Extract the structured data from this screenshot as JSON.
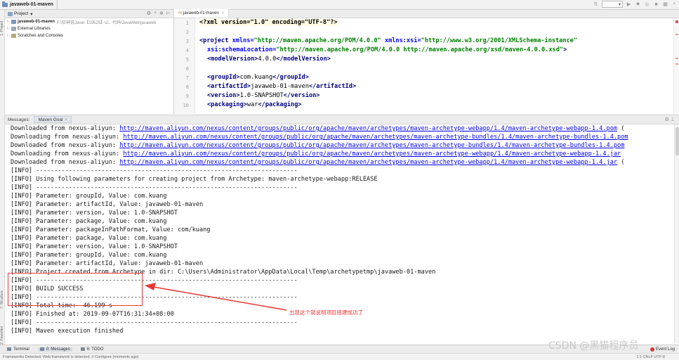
{
  "navbar": {
    "breadcrumb": "javaweb-01-maven",
    "run_config_value": "▾"
  },
  "left_strip": {
    "tabs": [
      "1: Project",
      "7: Structure",
      "2: Favorites"
    ]
  },
  "project_panel": {
    "title": "Project",
    "tree": [
      {
        "label": "javaweb-01-maven",
        "path": "F:\\狂神说Java\\【19525】\\2、代码\\JavaWeb\\javaweb"
      },
      {
        "label": "External Libraries",
        "path": ""
      },
      {
        "label": "Scratches and Consoles",
        "path": ""
      }
    ]
  },
  "editor": {
    "tab_label": "javaweb-01-maven",
    "line_numbers": [
      "1",
      "2",
      "3",
      "4",
      "5",
      "6",
      "7",
      "8",
      "9",
      "10"
    ],
    "lines": {
      "l1_pi": "<?xml version=\"1.0\" encoding=\"UTF-8\"?>",
      "l3_open": "<project ",
      "l3_a1": "xmlns=",
      "l3_v1": "\"http://maven.apache.org/POM/4.0.0\"",
      "l3_a2": " xmlns:xsi=",
      "l3_v2": "\"http://www.w3.org/2001/XMLSchema-instance\"",
      "l4_a": "xsi:schemaLocation=",
      "l4_v": "\"http://maven.apache.org/POM/4.0.0 http://maven.apache.org/xsd/maven-4.0.0.xsd\"",
      "l4_close": ">",
      "l5_o": "<modelVersion>",
      "l5_t": "4.0.0",
      "l5_c": "</modelVersion>",
      "l7_o": "<groupId>",
      "l7_t": "com.kuang",
      "l7_c": "</groupId>",
      "l8_o": "<artifactId>",
      "l8_t": "javaweb-01-maven",
      "l8_c": "</artifactId>",
      "l9_o": "<version>",
      "l9_t": "1.0-SNAPSHOT",
      "l9_c": "</version>",
      "l10_o": "<packaging>",
      "l10_t": "war",
      "l10_c": "</packaging>"
    }
  },
  "messages": {
    "label": "Messages:",
    "tab": "Maven Goal"
  },
  "console": {
    "downloads": [
      {
        "prefix": "Downloaded from nexus-aliyun: ",
        "url": "http://maven.aliyun.com/nexus/content/groups/public/org/apache/maven/archetypes/maven-archetype-webapp/1.4/maven-archetype-webapp-1.4.pom",
        "suffix": " ("
      },
      {
        "prefix": "Downloading from nexus-aliyun: ",
        "url": "http://maven.aliyun.com/nexus/content/groups/public/org/apache/maven/archetypes/maven-archetype-bundles/1.4/maven-archetype-bundles-1.4.pom",
        "suffix": ""
      },
      {
        "prefix": "Downloaded from nexus-aliyun: ",
        "url": "http://maven.aliyun.com/nexus/content/groups/public/org/apache/maven/archetypes/maven-archetype-bundles/1.4/maven-archetype-bundles-1.4.pom",
        "suffix": ""
      },
      {
        "prefix": "Downloading from nexus-aliyun: ",
        "url": "http://maven.aliyun.com/nexus/content/groups/public/org/apache/maven/archetypes/maven-archetype-webapp/1.4/maven-archetype-webapp-1.4.jar",
        "suffix": ""
      },
      {
        "prefix": "Downloaded from nexus-aliyun: ",
        "url": "http://maven.aliyun.com/nexus/content/groups/public/org/apache/maven/archetypes/maven-archetype-webapp/1.4/maven-archetype-webapp-1.4.jar",
        "suffix": " ("
      }
    ],
    "info_lines": [
      "[INFO] ------------------------------------------------------------------------",
      "[INFO] Using following parameters for creating project from Archetype: maven-archetype-webapp:RELEASE",
      "[INFO] ------------------------------------------------------------------------",
      "[INFO] Parameter: groupId, Value: com.kuang",
      "[INFO] Parameter: artifactId, Value: javaweb-01-maven",
      "[INFO] Parameter: version, Value: 1.0-SNAPSHOT",
      "[INFO] Parameter: package, Value: com.kuang",
      "[INFO] Parameter: packageInPathFormat, Value: com/kuang",
      "[INFO] Parameter: package, Value: com.kuang",
      "[INFO] Parameter: version, Value: 1.0-SNAPSHOT",
      "[INFO] Parameter: groupId, Value: com.kuang",
      "[INFO] Parameter: artifactId, Value: javaweb-01-maven",
      "[INFO] Project created from Archetype in dir: C:\\Users\\Administrator\\AppData\\Local\\Temp\\archetypetmp\\javaweb-01-maven",
      "[INFO] ------------------------------------------------------------------------",
      "[INFO] BUILD SUCCESS",
      "[INFO] ------------------------------------------------------------------------",
      "[INFO] Total time:  46.199 s",
      "[INFO] Finished at: 2019-09-07T16:31:34+08:00",
      "[INFO] ------------------------------------------------------------------------",
      "[INFO] Maven execution finished"
    ]
  },
  "annotation": {
    "text": "出现这个就说明项目搭建成功了"
  },
  "bottom_bar": {
    "tabs": [
      "Terminal",
      "0: Messages",
      "6: TODO"
    ],
    "event_log": "Event Log"
  },
  "status_bar": {
    "left": "Frameworks Detected: Web framework is detected. // Configure (moments ago)",
    "right": "1:1   CRLF   UTF-8"
  },
  "watermark": "CSDN @黑猫程序员",
  "colors": {
    "tag": "#000080",
    "attribute": "#0000ff",
    "value": "#008000",
    "link": "#0000ee",
    "annotation": "#e53935"
  }
}
